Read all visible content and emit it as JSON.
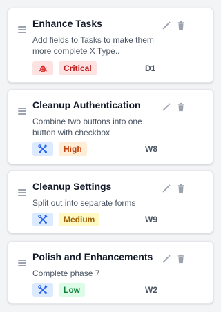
{
  "tasks": [
    {
      "title": "Enhance Tasks",
      "description": "Add fields to Tasks to make them more complete X Type..",
      "type_icon": "bug-icon",
      "priority": "Critical",
      "id": "D1"
    },
    {
      "title": "Cleanup Authentication",
      "description": "Combine two buttons into one button with checkbox",
      "type_icon": "tools-icon",
      "priority": "High",
      "id": "W8"
    },
    {
      "title": "Cleanup Settings",
      "description": "Split out into separate forms",
      "type_icon": "tools-icon",
      "priority": "Medium",
      "id": "W9"
    },
    {
      "title": "Polish and Enhancements",
      "description": "Complete phase 7",
      "type_icon": "tools-icon",
      "priority": "Low",
      "id": "W2"
    }
  ],
  "colors": {
    "critical_bg": "#fee2e2",
    "critical_text": "#b91c1c",
    "high_bg": "#ffedd5",
    "high_text": "#c2410c",
    "medium_bg": "#fef9c3",
    "medium_text": "#a16207",
    "low_bg": "#dcfce7",
    "low_text": "#15803d",
    "bug_icon": "#dc2626",
    "tools_icon": "#2563eb"
  }
}
